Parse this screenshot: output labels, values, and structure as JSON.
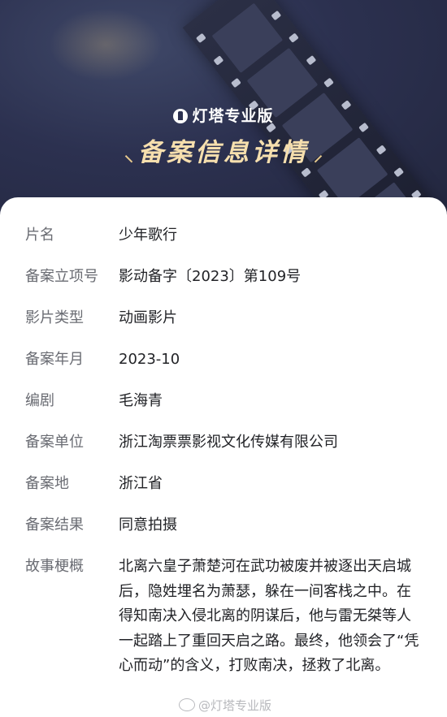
{
  "header": {
    "brand": "灯塔专业版",
    "title": "备案信息详情",
    "wing_left": "⸜",
    "wing_right": "⸝"
  },
  "fields": [
    {
      "label": "片名",
      "value": "少年歌行"
    },
    {
      "label": "备案立项号",
      "value": "影动备字〔2023〕第109号"
    },
    {
      "label": "影片类型",
      "value": "动画影片"
    },
    {
      "label": "备案年月",
      "value": "2023-10"
    },
    {
      "label": "编剧",
      "value": "毛海青"
    },
    {
      "label": "备案单位",
      "value": "浙江淘票票影视文化传媒有限公司"
    },
    {
      "label": "备案地",
      "value": "浙江省"
    },
    {
      "label": "备案结果",
      "value": "同意拍摄"
    },
    {
      "label": "故事梗概",
      "value": "北离六皇子萧楚河在武功被废并被逐出天启城后，隐姓埋名为萧瑟，躲在一间客栈之中。在得知南决入侵北离的阴谋后，他与雷无桀等人一起踏上了重回天启之路。最终，他领会了“凭心而动”的含义，打败南决，拯救了北离。"
    }
  ],
  "watermark": "@灯塔专业版",
  "icons": {
    "brand": "lighthouse-icon",
    "watermark": "weibo-icon"
  },
  "colors": {
    "header_bg": "#2c3150",
    "title": "#f6dfae",
    "label": "#6a6c73",
    "value": "#222327"
  }
}
